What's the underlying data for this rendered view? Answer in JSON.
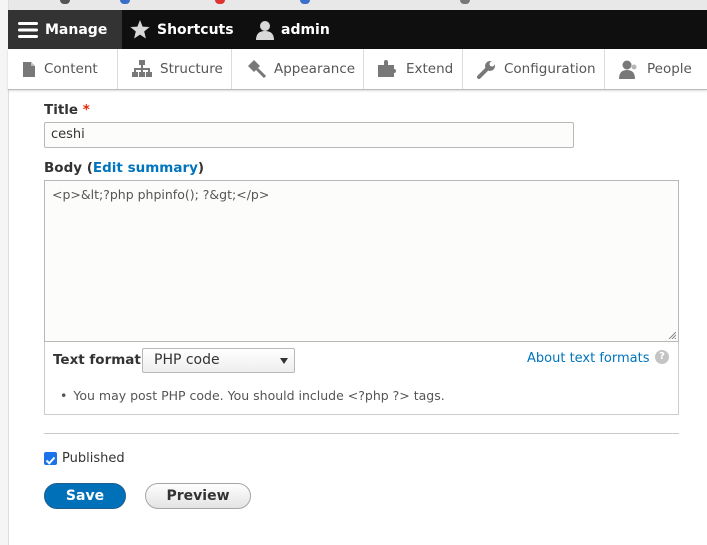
{
  "toolbar": {
    "manage": "Manage",
    "shortcuts": "Shortcuts",
    "user": "admin"
  },
  "tray": {
    "items": [
      {
        "label": "Content",
        "icon": "content-icon"
      },
      {
        "label": "Structure",
        "icon": "structure-icon"
      },
      {
        "label": "Appearance",
        "icon": "appearance-icon"
      },
      {
        "label": "Extend",
        "icon": "extend-icon"
      },
      {
        "label": "Configuration",
        "icon": "configuration-icon"
      },
      {
        "label": "People",
        "icon": "people-icon"
      }
    ]
  },
  "form": {
    "title_label": "Title",
    "required_mark": "*",
    "title_value": "ceshi",
    "body_label": "Body (",
    "edit_summary": "Edit summary",
    "body_label_end": ")",
    "body_value": "<p>&lt;?php phpinfo(); ?&gt;</p>",
    "text_format_label": "Text format",
    "text_format_value": "PHP code",
    "about_formats": "About text formats",
    "help_icon": "?",
    "tip_text": "You may post PHP code. You should include <?php ?> tags.",
    "published_label": "Published",
    "published_checked": true,
    "save_label": "Save",
    "preview_label": "Preview"
  },
  "colors": {
    "toolbar_bg": "#0f0f0f",
    "link": "#0074bd",
    "primary_button": "#0071b8",
    "required": "#e62600"
  }
}
